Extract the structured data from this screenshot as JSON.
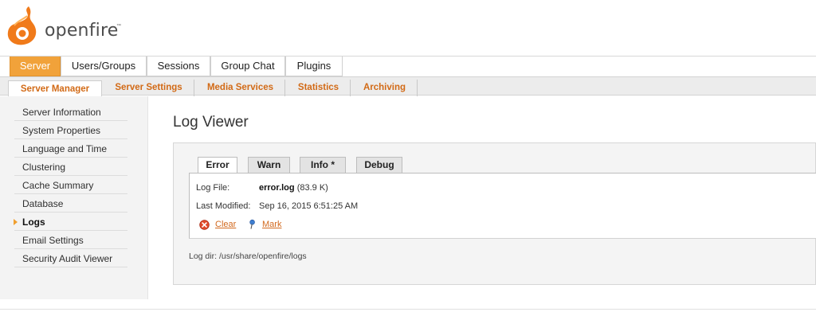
{
  "app": {
    "name": "openfire",
    "tm": "™"
  },
  "main_tabs": [
    {
      "label": "Server",
      "active": true
    },
    {
      "label": "Users/Groups",
      "active": false
    },
    {
      "label": "Sessions",
      "active": false
    },
    {
      "label": "Group Chat",
      "active": false
    },
    {
      "label": "Plugins",
      "active": false
    }
  ],
  "sub_tabs": [
    {
      "label": "Server Manager",
      "active": true
    },
    {
      "label": "Server Settings",
      "active": false
    },
    {
      "label": "Media Services",
      "active": false
    },
    {
      "label": "Statistics",
      "active": false
    },
    {
      "label": "Archiving",
      "active": false
    }
  ],
  "sidebar": {
    "items": [
      {
        "label": "Server Information"
      },
      {
        "label": "System Properties"
      },
      {
        "label": "Language and Time"
      },
      {
        "label": "Clustering"
      },
      {
        "label": "Cache Summary"
      },
      {
        "label": "Database"
      },
      {
        "label": "Logs",
        "active": true
      },
      {
        "label": "Email Settings"
      },
      {
        "label": "Security Audit Viewer"
      }
    ]
  },
  "page": {
    "title": "Log Viewer"
  },
  "log_tabs": [
    {
      "label": "Error",
      "active": true
    },
    {
      "label": "Warn"
    },
    {
      "label": "Info *"
    },
    {
      "label": "Debug"
    }
  ],
  "log_info": {
    "file_label": "Log File:",
    "file_name": "error.log",
    "file_size": "(83.9 K)",
    "modified_label": "Last Modified:",
    "modified_value": "Sep 16, 2015 6:51:25 AM"
  },
  "actions": {
    "clear": "Clear",
    "mark": "Mark"
  },
  "log_dir": "Log dir: /usr/share/openfire/logs",
  "colors": {
    "accent": "#f1a23a",
    "link": "#d2691e",
    "subtab_text": "#d26a16"
  }
}
